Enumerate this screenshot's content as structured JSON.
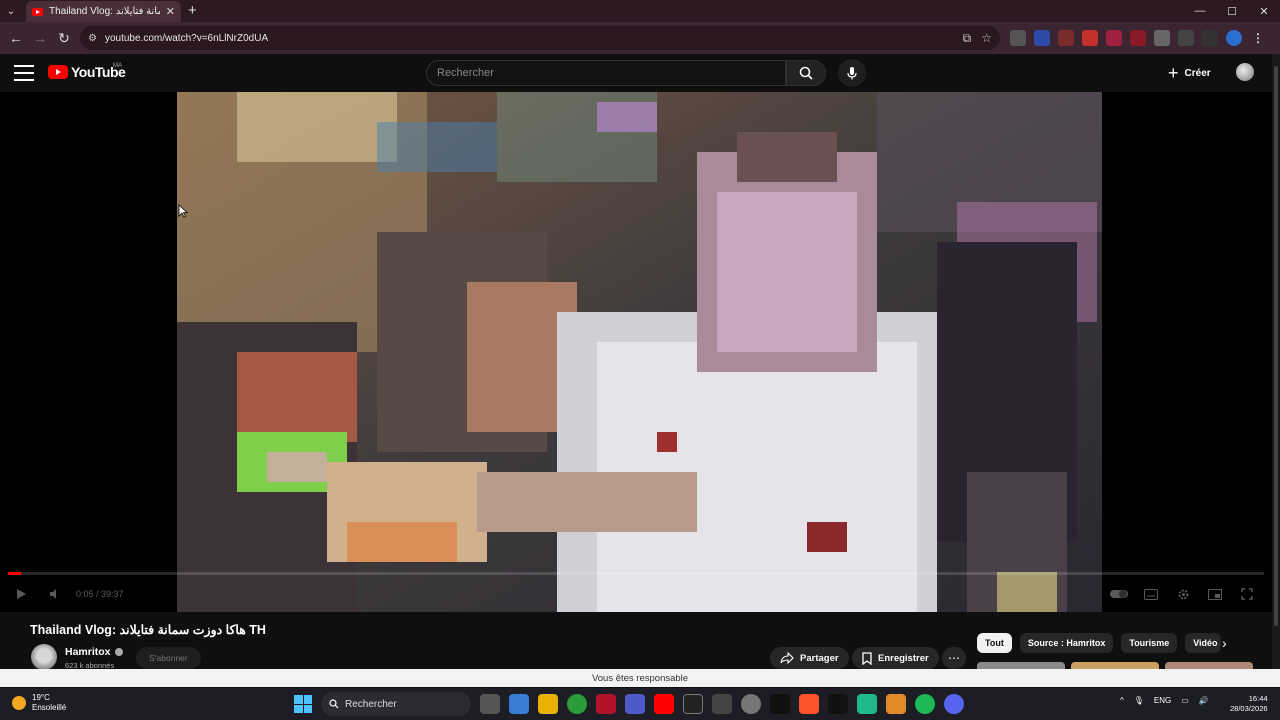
{
  "browser": {
    "tab_title": "Thailand Vlog: هاكا دوزت سمانة فتايلاند",
    "tab_close": "✕",
    "new_tab": "+",
    "url": "youtube.com/watch?v=6nLlNrZ0dUA",
    "window_controls": [
      "—",
      "☐",
      "✕"
    ]
  },
  "youtube": {
    "logo_text": "YouTube",
    "country_code": "MA",
    "search_placeholder": "Rechercher",
    "create_label": "Créer"
  },
  "player": {
    "progress_fraction": 0.002,
    "time": "0:05 / 39:37"
  },
  "video": {
    "title": "Thailand Vlog: هاكا دوزت سمانة فتايلاند TH",
    "channel_name": "Hamritox",
    "subscribers": "623 k abonnés",
    "subscribe_label": "S'abonner",
    "share_label": "Partager",
    "save_label": "Enregistrer",
    "more_label": "⋯"
  },
  "chips": [
    {
      "label": "Tout",
      "active": true
    },
    {
      "label": "Source : Hamritox",
      "active": false
    },
    {
      "label": "Tourisme",
      "active": false
    },
    {
      "label": "Vidéo",
      "active": false
    }
  ],
  "banner_text": "Vous êtes responsable",
  "taskbar": {
    "temperature": "19°C",
    "weather": "Ensoleillé",
    "search_label": "Rechercher",
    "language": "ENG",
    "time": "16:44",
    "date": "28/03/2026"
  },
  "colors": {
    "youtube_red": "#ff0000",
    "background": "#0f0f0f",
    "browser_chrome": "#3a2530"
  }
}
